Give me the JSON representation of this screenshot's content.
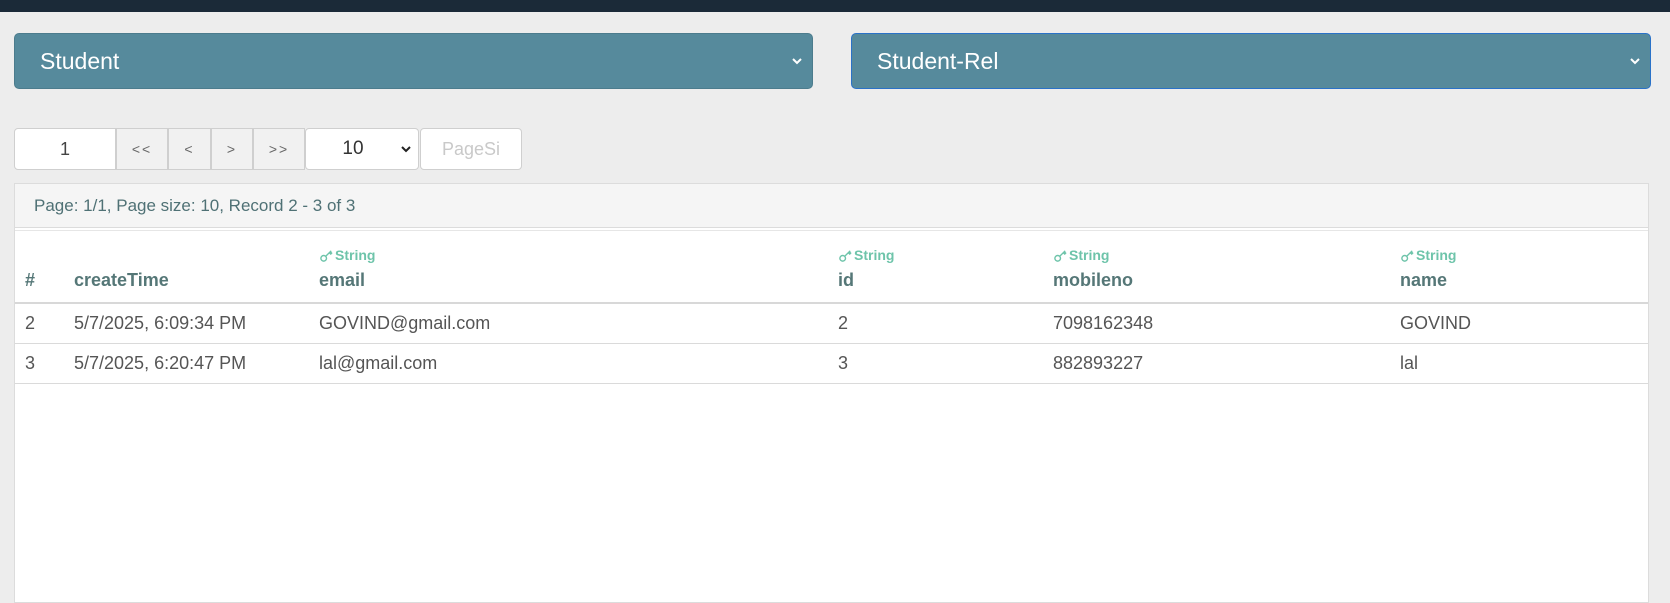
{
  "selectors": {
    "entity": "Student",
    "relation": "Student-Rel"
  },
  "pager": {
    "page_value": "1",
    "first_label": "<<",
    "prev_label": "<",
    "next_label": ">",
    "last_label": ">>",
    "page_size_value": "10",
    "page_size_placeholder": "PageSi"
  },
  "status": {
    "text": "Page: 1/1, Page size: 10, Record 2 - 3 of 3"
  },
  "table": {
    "columns": [
      {
        "name": "#",
        "type": ""
      },
      {
        "name": "createTime",
        "type": ""
      },
      {
        "name": "email",
        "type": "String"
      },
      {
        "name": "id",
        "type": "String"
      },
      {
        "name": "mobileno",
        "type": "String"
      },
      {
        "name": "name",
        "type": "String"
      }
    ],
    "rows": [
      [
        "2",
        "5/7/2025, 6:09:34 PM",
        "GOVIND@gmail.com",
        "2",
        "7098162348",
        "GOVIND"
      ],
      [
        "3",
        "5/7/2025, 6:20:47 PM",
        "lal@gmail.com",
        "3",
        "882893227",
        "lal"
      ]
    ]
  },
  "colors": {
    "topbar": "#1b2a38",
    "select_bg": "#568a9c",
    "type_accent": "#6ec4aa",
    "header_text": "#557777"
  },
  "icons": {
    "select_arrow": "chevron-down-icon",
    "type_marker": "key-icon"
  }
}
